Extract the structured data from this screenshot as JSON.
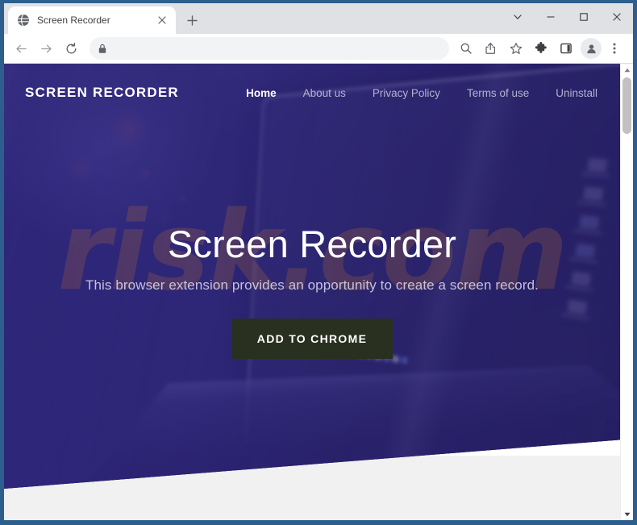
{
  "browser": {
    "tab": {
      "title": "Screen Recorder",
      "favicon_icon": "globe-icon",
      "close_icon": "close-icon"
    },
    "new_tab_icon": "plus-icon",
    "window_controls": {
      "chevron_icon": "chevron-down-icon",
      "minimize_icon": "minimize-icon",
      "maximize_icon": "maximize-icon",
      "close_icon": "close-icon"
    },
    "toolbar": {
      "back_icon": "back-arrow-icon",
      "forward_icon": "forward-arrow-icon",
      "reload_icon": "reload-icon",
      "lock_icon": "lock-icon",
      "url_value": "",
      "url_placeholder": "",
      "zoom_icon": "search-zoom-icon",
      "share_icon": "share-icon",
      "bookmark_icon": "star-icon",
      "extensions_icon": "puzzle-piece-icon",
      "side_panel_icon": "side-panel-icon",
      "profile_icon": "person-avatar-icon",
      "menu_icon": "three-dot-menu-icon"
    },
    "scrollbar": {
      "up_icon": "scroll-up-arrow-icon",
      "down_icon": "scroll-down-arrow-icon"
    }
  },
  "site": {
    "logo": "SCREEN RECORDER",
    "nav": [
      {
        "label": "Home",
        "active": true
      },
      {
        "label": "About us",
        "active": false
      },
      {
        "label": "Privacy Policy",
        "active": false
      },
      {
        "label": "Terms of use",
        "active": false
      },
      {
        "label": "Uninstall",
        "active": false
      }
    ],
    "hero": {
      "title": "Screen Recorder",
      "subtitle": "This browser extension provides an opportunity to create a screen record.",
      "cta_label": "ADD TO CHROME"
    },
    "watermark": "risk.com"
  },
  "colors": {
    "window_frame": "#2c5f8d",
    "hero_violet": "#2e2680",
    "cta_green": "#2a301f",
    "nav_active": "#ffffff",
    "nav_muted": "#d6d4e8",
    "watermark": "#d67e28",
    "page_body": "#f1f1f1"
  }
}
